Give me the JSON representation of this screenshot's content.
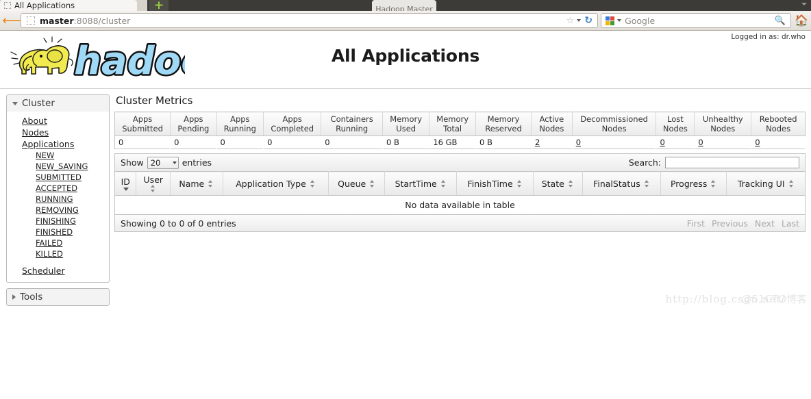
{
  "browser": {
    "tab_title": "All Applications",
    "background_tab_title": "Hadoop Master",
    "url_host": "master",
    "url_rest": ":8088/cluster",
    "search_engine": "Google",
    "icons": {
      "back": "back-arrow-icon",
      "bookmark": "star-icon",
      "reload": "reload-icon",
      "search": "magnifier-icon",
      "home": "home-icon",
      "newtab": "plus-icon"
    }
  },
  "header": {
    "logged_in": "Logged in as: dr.who",
    "page_title": "All Applications",
    "logo_alt": "hadoop"
  },
  "sidebar": {
    "cluster": {
      "label": "Cluster",
      "expanded": true,
      "items": [
        {
          "label": "About"
        },
        {
          "label": "Nodes"
        },
        {
          "label": "Applications"
        }
      ],
      "app_states": [
        {
          "label": "NEW"
        },
        {
          "label": "NEW_SAVING"
        },
        {
          "label": "SUBMITTED"
        },
        {
          "label": "ACCEPTED"
        },
        {
          "label": "RUNNING"
        },
        {
          "label": "REMOVING"
        },
        {
          "label": "FINISHING"
        },
        {
          "label": "FINISHED"
        },
        {
          "label": "FAILED"
        },
        {
          "label": "KILLED"
        }
      ],
      "scheduler": {
        "label": "Scheduler"
      }
    },
    "tools": {
      "label": "Tools",
      "expanded": false
    }
  },
  "main": {
    "metrics_title": "Cluster Metrics",
    "metrics": {
      "columns": [
        "Apps Submitted",
        "Apps Pending",
        "Apps Running",
        "Apps Completed",
        "Containers Running",
        "Memory Used",
        "Memory Total",
        "Memory Reserved",
        "Active Nodes",
        "Decommissioned Nodes",
        "Lost Nodes",
        "Unhealthy Nodes",
        "Rebooted Nodes"
      ],
      "values": [
        {
          "text": "0",
          "link": false
        },
        {
          "text": "0",
          "link": false
        },
        {
          "text": "0",
          "link": false
        },
        {
          "text": "0",
          "link": false
        },
        {
          "text": "0",
          "link": false
        },
        {
          "text": "0 B",
          "link": false
        },
        {
          "text": "16 GB",
          "link": false
        },
        {
          "text": "0 B",
          "link": false
        },
        {
          "text": "2",
          "link": true
        },
        {
          "text": "0",
          "link": true
        },
        {
          "text": "0",
          "link": true
        },
        {
          "text": "0",
          "link": true
        },
        {
          "text": "0",
          "link": true
        }
      ]
    },
    "table_controls": {
      "show_label": "Show",
      "entries_label": "entries",
      "page_length": "20",
      "search_label": "Search:",
      "search_value": "",
      "search_placeholder": ""
    },
    "apps_table": {
      "columns": [
        {
          "label": "ID",
          "sort": "desc"
        },
        {
          "label": "User",
          "sort": "both"
        },
        {
          "label": "Name",
          "sort": "both"
        },
        {
          "label": "Application Type",
          "sort": "both"
        },
        {
          "label": "Queue",
          "sort": "both"
        },
        {
          "label": "StartTime",
          "sort": "both"
        },
        {
          "label": "FinishTime",
          "sort": "both"
        },
        {
          "label": "State",
          "sort": "both"
        },
        {
          "label": "FinalStatus",
          "sort": "both"
        },
        {
          "label": "Progress",
          "sort": "both"
        },
        {
          "label": "Tracking UI",
          "sort": "both"
        }
      ],
      "rows": [],
      "empty_message": "No data available in table"
    },
    "footer": {
      "info": "Showing 0 to 0 of 0 entries",
      "pagination": [
        "First",
        "Previous",
        "Next",
        "Last"
      ]
    }
  },
  "watermark": {
    "url": "http://blog.csdn.net/",
    "overlay": "@51CTO博客"
  }
}
